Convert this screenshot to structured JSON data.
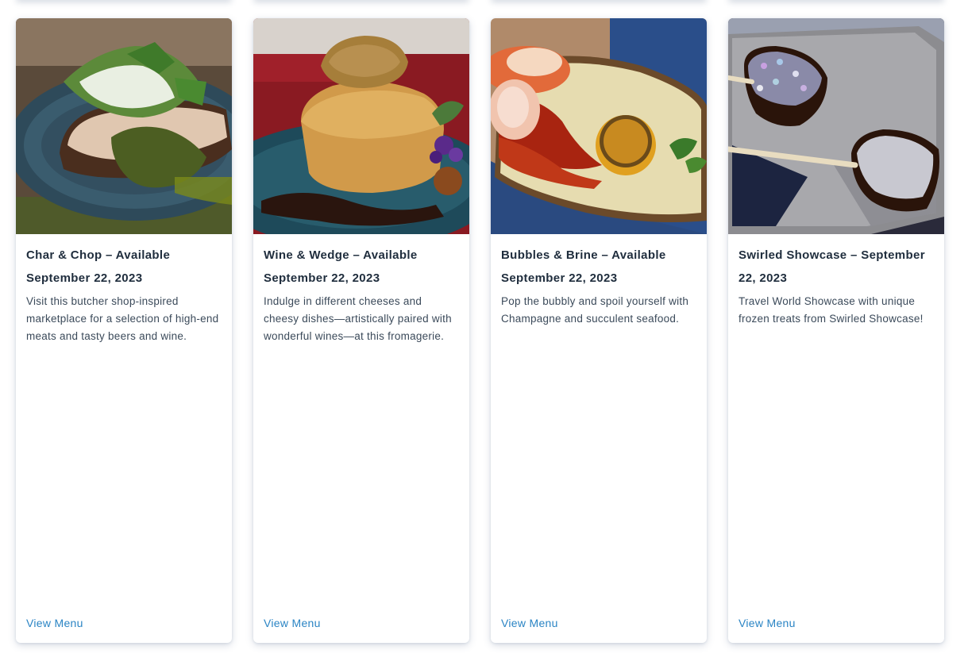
{
  "cards": [
    {
      "title": "Char & Chop – Available September 22, 2023",
      "description": "Visit this butcher shop-inspired marketplace for a selection of high-end meats and tasty beers and wine.",
      "link_label": "View Menu",
      "image": "sliced pork with chimichurri and arugula salad on a blue plate"
    },
    {
      "title": "Wine & Wedge – Available September 22, 2023",
      "description": "Indulge in different cheeses and cheesy dishes—artistically paired with wonderful wines—at this fromagerie.",
      "link_label": "View Menu",
      "image": "cheese soufflé with herb butter and balsamic drizzle"
    },
    {
      "title": "Bubbles & Brine – Available September 22, 2023",
      "description": "Pop the bubbly and spoil yourself with Champagne and succulent seafood.",
      "link_label": "View Menu",
      "image": "shrimp with grilled lemon on an oval plate"
    },
    {
      "title": "Swirled Showcase – September 22, 2023",
      "description": "Travel World Showcase with unique frozen treats from Swirled Showcase!",
      "link_label": "View Menu",
      "image": "chocolate dipped frozen treats on sticks with sprinkles"
    }
  ],
  "colors": {
    "title": "#1f2d3d",
    "body": "#3b4a5a",
    "link": "#2a84c4"
  }
}
